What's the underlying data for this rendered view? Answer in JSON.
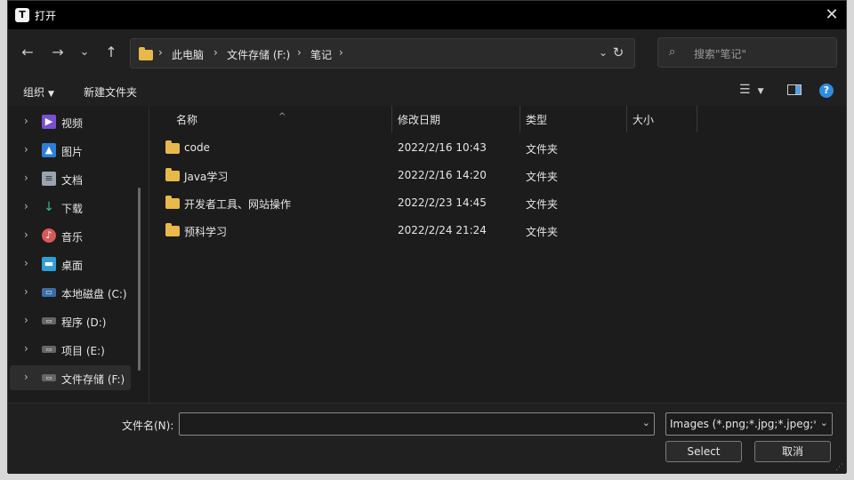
{
  "window": {
    "title": "打开",
    "app_icon_letter": "T",
    "close_glyph": "✕"
  },
  "nav": {
    "back": "←",
    "forward": "→",
    "recent": "⌄",
    "up": "↑"
  },
  "address": {
    "crumbs": [
      "此电脑",
      "文件存储 (F:)",
      "笔记"
    ],
    "separator": "›",
    "dropdown": "⌄",
    "refresh": "↻"
  },
  "search": {
    "placeholder": "搜索\"笔记\"",
    "icon": "⌕"
  },
  "toolbar": {
    "organize": "组织",
    "new_folder": "新建文件夹",
    "view_icon": "☰",
    "help": "?"
  },
  "sidebar": {
    "items": [
      {
        "label": "视频",
        "icon": "video-icon",
        "color": "#7a4fd0",
        "glyph": "▶"
      },
      {
        "label": "图片",
        "icon": "picture-icon",
        "color": "#2f7fd6",
        "glyph": "▲"
      },
      {
        "label": "文档",
        "icon": "document-icon",
        "color": "#9aa4b0",
        "glyph": "≡"
      },
      {
        "label": "下载",
        "icon": "download-icon",
        "color": "#1c1c1c",
        "glyph": "↓"
      },
      {
        "label": "音乐",
        "icon": "music-icon",
        "color": "#d65a5a",
        "glyph": "♪"
      },
      {
        "label": "桌面",
        "icon": "desktop-icon",
        "color": "#2f9fd6",
        "glyph": "▬"
      },
      {
        "label": "本地磁盘 (C:)",
        "icon": "drive-icon",
        "color": "#3a6ea8",
        "glyph": "▭"
      },
      {
        "label": "程序 (D:)",
        "icon": "drive-icon",
        "color": "#666",
        "glyph": "▭"
      },
      {
        "label": "项目 (E:)",
        "icon": "drive-icon",
        "color": "#666",
        "glyph": "▭"
      },
      {
        "label": "文件存储 (F:)",
        "icon": "drive-icon",
        "color": "#666",
        "glyph": "▭"
      }
    ],
    "chevron": "›"
  },
  "columns": {
    "name": "名称",
    "modified": "修改日期",
    "type": "类型",
    "size": "大小",
    "sort_arrow": "^"
  },
  "files": [
    {
      "name": "code",
      "modified": "2022/2/16 10:43",
      "type": "文件夹",
      "size": ""
    },
    {
      "name": "Java学习",
      "modified": "2022/2/16 14:20",
      "type": "文件夹",
      "size": ""
    },
    {
      "name": "开发者工具、网站操作",
      "modified": "2022/2/23 14:45",
      "type": "文件夹",
      "size": ""
    },
    {
      "name": "预科学习",
      "modified": "2022/2/24 21:24",
      "type": "文件夹",
      "size": ""
    }
  ],
  "footer": {
    "filename_label": "文件名(N):",
    "filename_value": "",
    "dropdown": "⌄",
    "file_type": "Images (*.png;*.jpg;*.jpeg;*.b",
    "select_button": "Select",
    "cancel_button": "取消"
  },
  "colors": {
    "accent": "#2f8ce0",
    "folder": "#e8b94a",
    "background": "#1c1c1c"
  }
}
